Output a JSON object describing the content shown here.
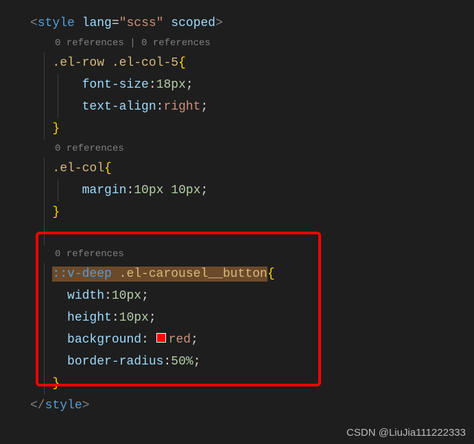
{
  "code": {
    "open_tag": {
      "lt": "<",
      "name": "style",
      "attr1": "lang",
      "eq": "=",
      "val1": "\"scss\"",
      "attr2": "scoped",
      "gt": ">"
    },
    "close_tag": {
      "lt": "</",
      "name": "style",
      "gt": ">"
    },
    "lens1": "0 references | 0 references",
    "rule1": {
      "sel1": ".el-row",
      "sel2": ".el-col-5",
      "brace_o": "{",
      "p1": "font-size",
      "v1a": "18",
      "v1b": "px",
      "p2": "text-align",
      "v2": "right",
      "semi": ";",
      "brace_c": "}"
    },
    "lens2": "0 references",
    "rule2": {
      "sel": ".el-col",
      "brace_o": "{",
      "p1": "margin",
      "v1a": "10",
      "v1b": "px",
      "v2a": "10",
      "v2b": "px",
      "semi": ";",
      "brace_c": "}"
    },
    "lens3": "0 references",
    "rule3": {
      "ps1": "::",
      "ps2": "v-deep",
      "sel": ".el-carousel__button",
      "brace_o": "{",
      "p1": "width",
      "v1a": "10",
      "v1b": "px",
      "p2": "height",
      "v2a": "10",
      "v2b": "px",
      "p3": "background",
      "v3": "red",
      "p4": "border-radius",
      "v4a": "50",
      "v4b": "%",
      "semi": ";",
      "brace_c": "}"
    }
  },
  "watermark": "CSDN @LiuJia111222333"
}
